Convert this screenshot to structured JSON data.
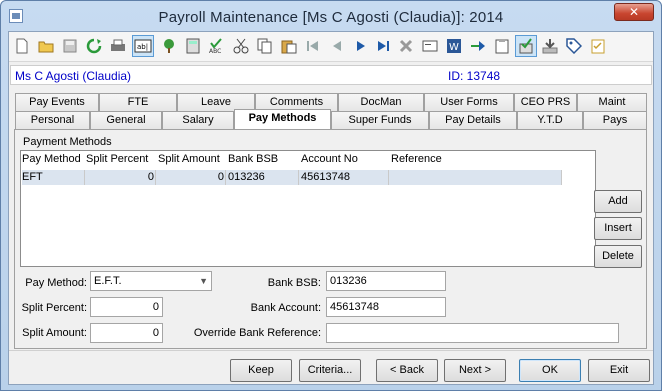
{
  "window": {
    "title": "Payroll Maintenance  [Ms C Agosti (Claudia)]:  2014",
    "close_glyph": "✕"
  },
  "toolbar": {
    "icons": [
      "new-icon",
      "open-icon",
      "save-icon",
      "refresh-icon",
      "print-icon",
      "text-field-icon",
      "tree-icon",
      "calculator-icon",
      "spellcheck-icon",
      "cut-icon",
      "copy-icon",
      "paste-icon",
      "first-record-icon",
      "previous-record-icon",
      "next-record-icon",
      "last-record-icon",
      "delete-icon",
      "card-icon",
      "word-icon",
      "arrow-icon",
      "clipboard-icon",
      "approve-icon",
      "download-icon",
      "tag-icon",
      "checklist-icon"
    ]
  },
  "employee": {
    "name": "Ms C Agosti (Claudia)",
    "id_text": "ID: 13748"
  },
  "tabs": {
    "row1": [
      "Pay Events",
      "FTE",
      "Leave",
      "Comments",
      "DocMan",
      "User Forms",
      "CEO PRS",
      "Maint"
    ],
    "row2": [
      "Personal",
      "General",
      "Salary",
      "Pay Methods",
      "Super Funds",
      "Pay Details",
      "Y.T.D",
      "Pays"
    ],
    "selected": "Pay Methods"
  },
  "payment_methods": {
    "group_label": "Payment Methods",
    "columns": [
      "Pay Method",
      "Split Percent",
      "Split Amount",
      "Bank BSB",
      "Account No",
      "Reference"
    ],
    "rows": [
      {
        "pay_method": "EFT",
        "split_percent": "0",
        "split_amount": "0",
        "bank_bsb": "013236",
        "account_no": "45613748",
        "reference": ""
      }
    ],
    "add_label": "Add",
    "insert_label": "Insert",
    "delete_label": "Delete"
  },
  "form": {
    "pay_method_label": "Pay Method:",
    "pay_method_value": "E.F.T.",
    "split_percent_label": "Split Percent:",
    "split_percent_value": "0",
    "split_amount_label": "Split Amount:",
    "split_amount_value": "0",
    "bank_bsb_label": "Bank BSB:",
    "bank_bsb_value": "013236",
    "bank_account_label": "Bank Account:",
    "bank_account_value": "45613748",
    "override_ref_label": "Override Bank Reference:",
    "override_ref_value": ""
  },
  "footer": {
    "keep": "Keep",
    "criteria": "Criteria...",
    "back": "< Back",
    "next": "Next >",
    "ok": "OK",
    "exit": "Exit"
  }
}
